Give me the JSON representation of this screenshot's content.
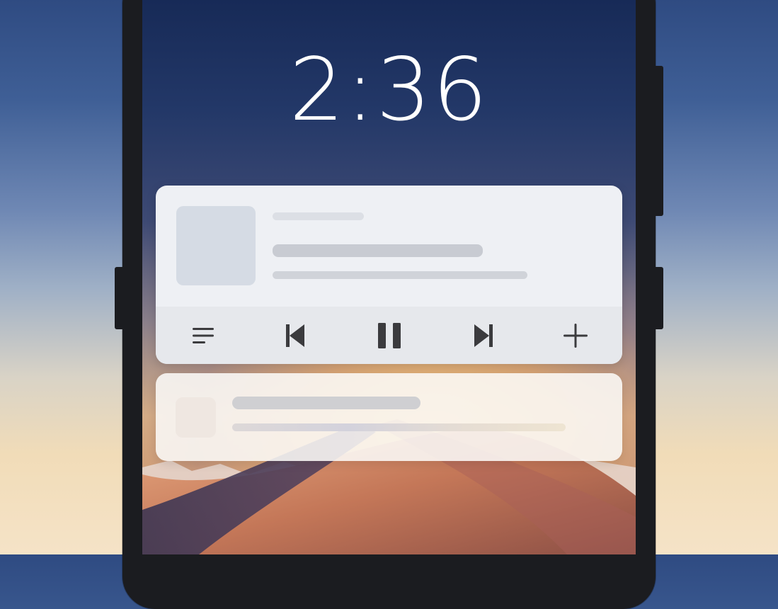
{
  "lockscreen": {
    "time": "2:36"
  },
  "media_notification": {
    "controls": {
      "queue_icon": "list-icon",
      "previous_icon": "skip-previous-icon",
      "play_pause_icon": "pause-icon",
      "next_icon": "skip-next-icon",
      "add_icon": "plus-icon"
    },
    "colors": {
      "card_background": "#eef0f4",
      "controls_background": "#e6e8ec",
      "icon_color": "#3b3b3e"
    }
  },
  "second_notification": {
    "colors": {
      "card_background": "#faf9f7"
    }
  }
}
